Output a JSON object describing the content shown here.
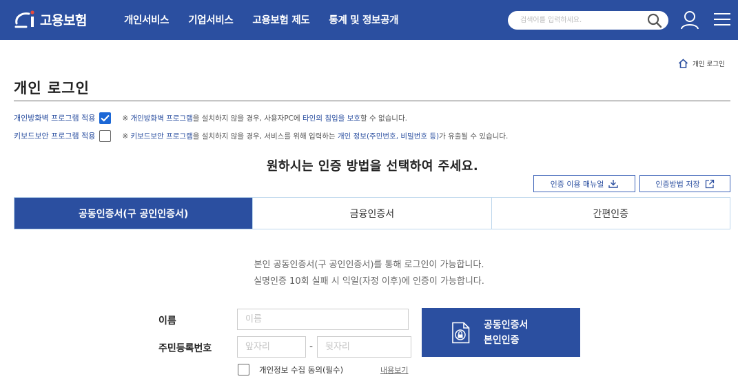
{
  "header": {
    "logo_text": "고용보험",
    "nav": [
      "개인서비스",
      "기업서비스",
      "고용보험 제도",
      "통계 및 정보공개"
    ],
    "search_placeholder": "검색어를 입력하세요."
  },
  "breadcrumb": {
    "label": "개인 로그인"
  },
  "page_title": "개인 로그인",
  "security": {
    "firewall": {
      "label": "개인방화벽 프로그램 적용",
      "checked": true,
      "note_prefix": "※ ",
      "note_hl1": "개인방화벽 프로그램",
      "note_mid": "을 설치하지 않을 경우, 사용자PC에 ",
      "note_hl2": "타인의 침입을 보호",
      "note_end": "할 수 없습니다."
    },
    "keyboard": {
      "label": "키보드보안 프로그램 적용",
      "checked": false,
      "note_prefix": "※ ",
      "note_hl1": "키보드보안 프로그램",
      "note_mid": "을 설치하지 않을 경우, 서비스를 위해 입력하는 ",
      "note_hl2": "개인 정보(주민번호, 비밀번호 등)",
      "note_end": "가 유출될 수 있습니다."
    }
  },
  "heading": "원하시는 인증 방법을 선택하여 주세요.",
  "tools": {
    "manual": "인증 이용 매뉴얼",
    "save": "인증방법 저장"
  },
  "tabs": [
    {
      "label": "공동인증서(구 공인인증서)",
      "active": true
    },
    {
      "label": "금융인증서",
      "active": false
    },
    {
      "label": "간편인증",
      "active": false
    }
  ],
  "description": [
    "본인 공동인증서(구 공인인증서)를 통해 로그인이 가능합니다.",
    "실명인증 10회 실패 시 익일(자정 이후)에 인증이 가능합니다."
  ],
  "form": {
    "name_label": "이름",
    "name_placeholder": "이름",
    "rrn_label": "주민등록번호",
    "rrn_front_placeholder": "앞자리",
    "rrn_dash": "-",
    "rrn_back_placeholder": "뒷자리",
    "cert_button_line1": "공동인증서",
    "cert_button_line2": "본인인증",
    "agree_label": "개인정보 수집 동의(필수)",
    "agree_link": "내용보기"
  },
  "colors": {
    "brand": "#2b4fa0",
    "checkbox": "#1b67d6",
    "tab_border": "#bcd6ec"
  }
}
